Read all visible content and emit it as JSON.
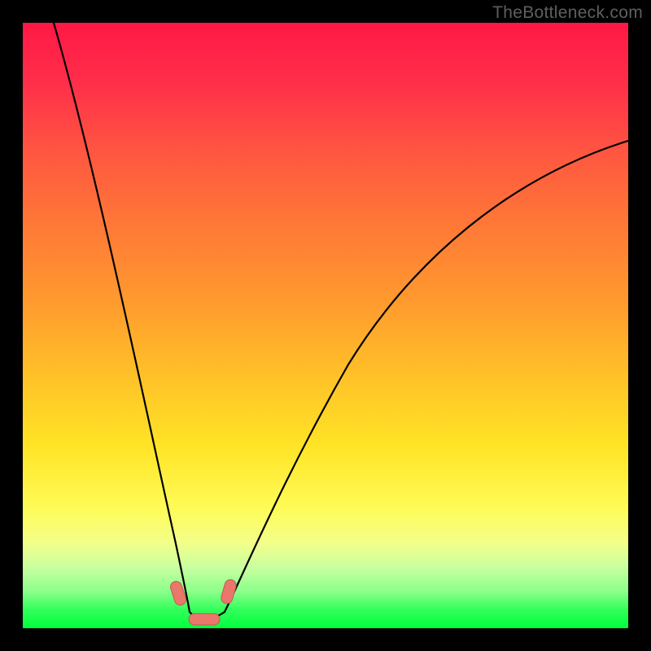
{
  "watermark": "TheBottleneck.com",
  "chart_data": {
    "type": "line",
    "title": "",
    "xlabel": "",
    "ylabel": "",
    "xlim": [
      0,
      100
    ],
    "ylim": [
      0,
      100
    ],
    "grid": false,
    "legend": false,
    "note": "Values estimated from pixel positions; axes have no printed tick labels.",
    "series": [
      {
        "name": "left-branch",
        "x": [
          5,
          8,
          11,
          14,
          17,
          20,
          22,
          24,
          25.5,
          26.5,
          27.2
        ],
        "y": [
          100,
          86,
          72,
          58,
          44,
          30,
          20,
          12,
          6,
          2,
          0
        ]
      },
      {
        "name": "valley-floor",
        "x": [
          27.2,
          30.0,
          33.0
        ],
        "y": [
          0,
          0,
          0
        ]
      },
      {
        "name": "right-branch",
        "x": [
          33.0,
          35,
          38,
          42,
          47,
          53,
          60,
          68,
          77,
          87,
          100
        ],
        "y": [
          0,
          3,
          8,
          15,
          24,
          34,
          45,
          56,
          66,
          74,
          80
        ]
      }
    ],
    "markers": [
      {
        "name": "valley-left-cluster",
        "x": 25.8,
        "y": 4.5
      },
      {
        "name": "valley-floor-cluster",
        "x": 29.5,
        "y": 0.5
      },
      {
        "name": "valley-right-cluster",
        "x": 33.5,
        "y": 4.0
      }
    ],
    "colors": {
      "gradient_top": "#ff1846",
      "gradient_mid": "#ffe426",
      "gradient_bottom": "#00ff3c",
      "curve": "#000000",
      "marker_fill": "#e9776b"
    }
  }
}
